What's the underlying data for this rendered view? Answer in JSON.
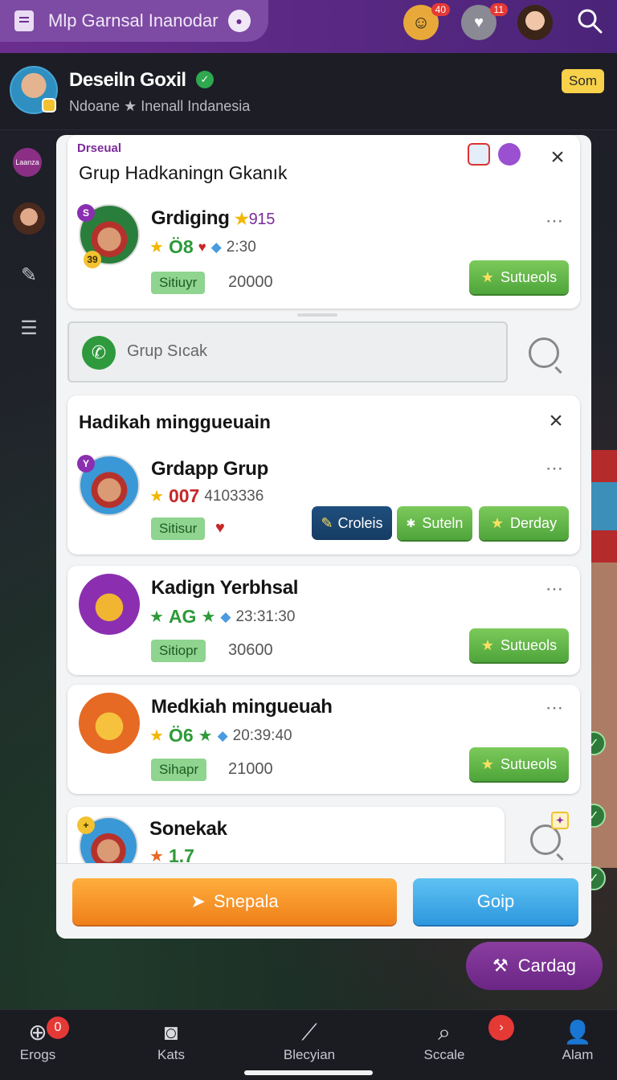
{
  "topbar": {
    "title": "Mlp Garnsal Inanodar",
    "badges": [
      "40",
      "11"
    ]
  },
  "profile": {
    "name": "Deseiln Goxil",
    "subtitle": "Ndoane ★ Inenall Indanesia",
    "badge": "Som"
  },
  "rail": {
    "first_label": "Laanza"
  },
  "panel": {
    "section_tag": "Drseual",
    "section_title": "Grup Hadkaningn Gkanık",
    "search_placeholder": "Grup Sıcak",
    "section2_title": "Hadikah minggueuain"
  },
  "rows": [
    {
      "name": "Grdiging",
      "name_suffix_star": "★",
      "name_suffix": "915",
      "meta_code": "Ö8",
      "meta_time": "2:30",
      "status": "Sitiuyr",
      "amount": "20000",
      "button": "Sutueols",
      "mini_badge": "S",
      "level_badge": "39"
    },
    {
      "name": "Grdapp Grup",
      "meta_code": "007",
      "meta_extra": "4103336",
      "status": "Sitisur",
      "buttons": [
        "Croleis",
        "Suteln",
        "Derday"
      ],
      "mini_badge": "Y"
    },
    {
      "name": "Kadign Yerbhsal",
      "meta_code": "AG",
      "meta_time": "23:31:30",
      "status": "Sitiopr",
      "amount": "30600",
      "button": "Sutueols"
    },
    {
      "name": "Medkiah mingueuah",
      "meta_code": "Ö6",
      "meta_time": "20:39:40",
      "status": "Sihapr",
      "amount": "21000",
      "button": "Sutueols"
    },
    {
      "name": "Sonekak",
      "meta_code": "1.7"
    }
  ],
  "actions": {
    "primary": "Snepala",
    "secondary": "Goip"
  },
  "fab": {
    "label": "Cardag"
  },
  "nav": {
    "items": [
      {
        "label": "Erogs",
        "badge": "0"
      },
      {
        "label": "Kats"
      },
      {
        "label": "Blecyian"
      },
      {
        "label": "Sccale"
      },
      {
        "label": "Alam"
      }
    ]
  }
}
